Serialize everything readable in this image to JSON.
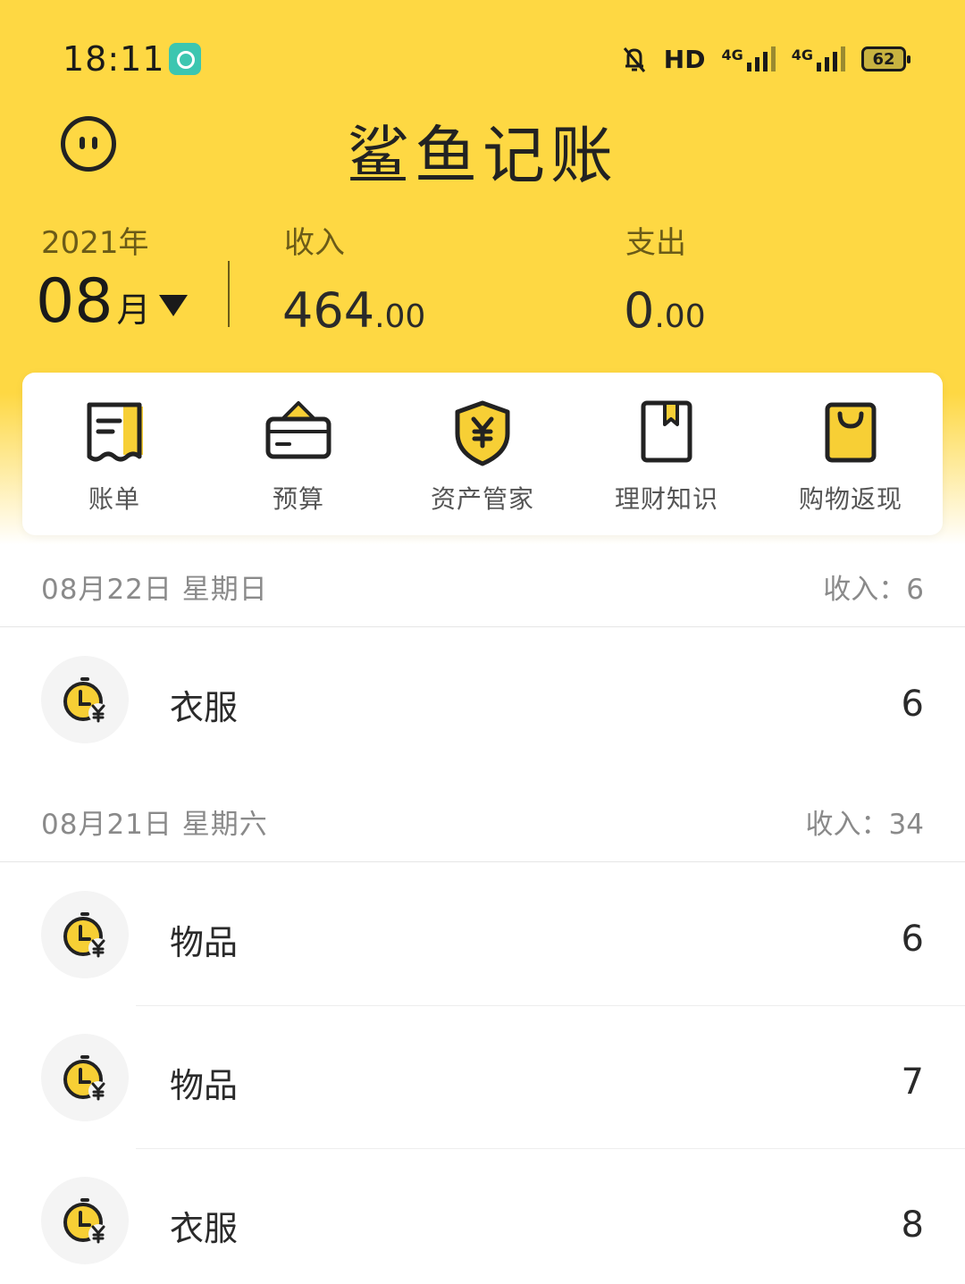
{
  "status_bar": {
    "time": "18:11",
    "hd": "HD",
    "net1": "4G",
    "net2": "4G",
    "battery": "62"
  },
  "header": {
    "title": "鲨鱼记账",
    "year": "2021年",
    "month": "08",
    "month_unit": "月",
    "income_label": "收入",
    "income_int": "464",
    "income_dec": ".00",
    "expense_label": "支出",
    "expense_int": "0",
    "expense_dec": ".00"
  },
  "menu": {
    "bill": "账单",
    "budget": "预算",
    "assets": "资产管家",
    "finance": "理财知识",
    "cashback": "购物返现"
  },
  "days": [
    {
      "date": "08月22日 星期日",
      "summary": "收入：6",
      "records": [
        {
          "name": "衣服",
          "amount": "6"
        }
      ]
    },
    {
      "date": "08月21日 星期六",
      "summary": "收入：34",
      "records": [
        {
          "name": "物品",
          "amount": "6"
        },
        {
          "name": "物品",
          "amount": "7"
        },
        {
          "name": "衣服",
          "amount": "8"
        }
      ]
    }
  ],
  "colors": {
    "brand_yellow": "#FED843",
    "icon_yellow": "#F7CF35",
    "dark": "#222222"
  }
}
